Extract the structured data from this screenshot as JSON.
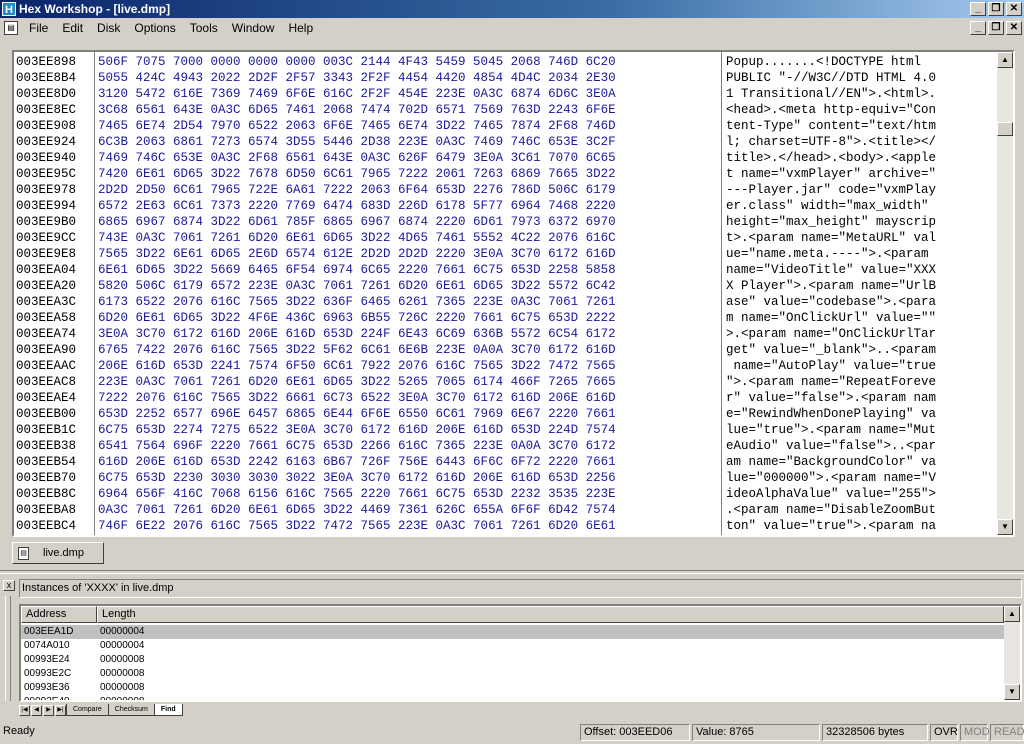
{
  "window": {
    "app_icon_glyph": "H",
    "title": "Hex Workshop - [live.dmp]",
    "min_glyph": "_",
    "max_glyph": "❐",
    "close_glyph": "✕"
  },
  "menu": {
    "doc_icon": "page-icon",
    "items": [
      "File",
      "Edit",
      "Disk",
      "Options",
      "Tools",
      "Window",
      "Help"
    ]
  },
  "hex_view": {
    "rows": [
      {
        "addr": "003EE898",
        "hex": "506F 7075 7000 0000 0000 0000 003C 2144 4F43 5459 5045 2068 746D 6C20",
        "ascii": "Popup.......<!DOCTYPE html "
      },
      {
        "addr": "003EE8B4",
        "hex": "5055 424C 4943 2022 2D2F 2F57 3343 2F2F 4454 4420 4854 4D4C 2034 2E30",
        "ascii": "PUBLIC \"-//W3C//DTD HTML 4.0"
      },
      {
        "addr": "003EE8D0",
        "hex": "3120 5472 616E 7369 7469 6F6E 616C 2F2F 454E 223E 0A3C 6874 6D6C 3E0A",
        "ascii": "1 Transitional//EN\">.<html>."
      },
      {
        "addr": "003EE8EC",
        "hex": "3C68 6561 643E 0A3C 6D65 7461 2068 7474 702D 6571 7569 763D 2243 6F6E",
        "ascii": "<head>.<meta http-equiv=\"Con"
      },
      {
        "addr": "003EE908",
        "hex": "7465 6E74 2D54 7970 6522 2063 6F6E 7465 6E74 3D22 7465 7874 2F68 746D",
        "ascii": "tent-Type\" content=\"text/htm"
      },
      {
        "addr": "003EE924",
        "hex": "6C3B 2063 6861 7273 6574 3D55 5446 2D38 223E 0A3C 7469 746C 653E 3C2F",
        "ascii": "l; charset=UTF-8\">.<title></"
      },
      {
        "addr": "003EE940",
        "hex": "7469 746C 653E 0A3C 2F68 6561 643E 0A3C 626F 6479 3E0A 3C61 7070 6C65",
        "ascii": "title>.</head>.<body>.<apple"
      },
      {
        "addr": "003EE95C",
        "hex": "7420 6E61 6D65 3D22 7678 6D50 6C61 7965 7222 2061 7263 6869 7665 3D22",
        "ascii": "t name=\"vxmPlayer\" archive=\""
      },
      {
        "addr": "003EE978",
        "hex": "2D2D 2D50 6C61 7965 722E 6A61 7222 2063 6F64 653D 2276 786D 506C 6179",
        "ascii": "---Player.jar\" code=\"vxmPlay"
      },
      {
        "addr": "003EE994",
        "hex": "6572 2E63 6C61 7373 2220 7769 6474 683D 226D 6178 5F77 6964 7468 2220",
        "ascii": "er.class\" width=\"max_width\" "
      },
      {
        "addr": "003EE9B0",
        "hex": "6865 6967 6874 3D22 6D61 785F 6865 6967 6874 2220 6D61 7973 6372 6970",
        "ascii": "height=\"max_height\" mayscrip"
      },
      {
        "addr": "003EE9CC",
        "hex": "743E 0A3C 7061 7261 6D20 6E61 6D65 3D22 4D65 7461 5552 4C22 2076 616C",
        "ascii": "t>.<param name=\"MetaURL\" val"
      },
      {
        "addr": "003EE9E8",
        "hex": "7565 3D22 6E61 6D65 2E6D 6574 612E 2D2D 2D2D 2220 3E0A 3C70 6172 616D",
        "ascii": "ue=\"name.meta.----\">.<param "
      },
      {
        "addr": "003EEA04",
        "hex": "6E61 6D65 3D22 5669 6465 6F54 6974 6C65 2220 7661 6C75 653D 2258 5858",
        "ascii": "name=\"VideoTitle\" value=\"XXX"
      },
      {
        "addr": "003EEA20",
        "hex": "5820 506C 6179 6572 223E 0A3C 7061 7261 6D20 6E61 6D65 3D22 5572 6C42",
        "ascii": "X Player\">.<param name=\"UrlB"
      },
      {
        "addr": "003EEA3C",
        "hex": "6173 6522 2076 616C 7565 3D22 636F 6465 6261 7365 223E 0A3C 7061 7261",
        "ascii": "ase\" value=\"codebase\">.<para"
      },
      {
        "addr": "003EEA58",
        "hex": "6D20 6E61 6D65 3D22 4F6E 436C 6963 6B55 726C 2220 7661 6C75 653D 2222",
        "ascii": "m name=\"OnClickUrl\" value=\"\""
      },
      {
        "addr": "003EEA74",
        "hex": "3E0A 3C70 6172 616D 206E 616D 653D 224F 6E43 6C69 636B 5572 6C54 6172",
        "ascii": ">.<param name=\"OnClickUrlTar"
      },
      {
        "addr": "003EEA90",
        "hex": "6765 7422 2076 616C 7565 3D22 5F62 6C61 6E6B 223E 0A0A 3C70 6172 616D",
        "ascii": "get\" value=\"_blank\">..<param"
      },
      {
        "addr": "003EEAAC",
        "hex": "206E 616D 653D 2241 7574 6F50 6C61 7922 2076 616C 7565 3D22 7472 7565",
        "ascii": " name=\"AutoPlay\" value=\"true"
      },
      {
        "addr": "003EEAC8",
        "hex": "223E 0A3C 7061 7261 6D20 6E61 6D65 3D22 5265 7065 6174 466F 7265 7665",
        "ascii": "\">.<param name=\"RepeatForeve"
      },
      {
        "addr": "003EEAE4",
        "hex": "7222 2076 616C 7565 3D22 6661 6C73 6522 3E0A 3C70 6172 616D 206E 616D",
        "ascii": "r\" value=\"false\">.<param nam"
      },
      {
        "addr": "003EEB00",
        "hex": "653D 2252 6577 696E 6457 6865 6E44 6F6E 6550 6C61 7969 6E67 2220 7661",
        "ascii": "e=\"RewindWhenDonePlaying\" va"
      },
      {
        "addr": "003EEB1C",
        "hex": "6C75 653D 2274 7275 6522 3E0A 3C70 6172 616D 206E 616D 653D 224D 7574",
        "ascii": "lue=\"true\">.<param name=\"Mut"
      },
      {
        "addr": "003EEB38",
        "hex": "6541 7564 696F 2220 7661 6C75 653D 2266 616C 7365 223E 0A0A 3C70 6172",
        "ascii": "eAudio\" value=\"false\">..<par"
      },
      {
        "addr": "003EEB54",
        "hex": "616D 206E 616D 653D 2242 6163 6B67 726F 756E 6443 6F6C 6F72 2220 7661",
        "ascii": "am name=\"BackgroundColor\" va"
      },
      {
        "addr": "003EEB70",
        "hex": "6C75 653D 2230 3030 3030 3022 3E0A 3C70 6172 616D 206E 616D 653D 2256",
        "ascii": "lue=\"000000\">.<param name=\"V"
      },
      {
        "addr": "003EEB8C",
        "hex": "6964 656F 416C 7068 6156 616C 7565 2220 7661 6C75 653D 2232 3535 223E",
        "ascii": "ideoAlphaValue\" value=\"255\">"
      },
      {
        "addr": "003EEBA8",
        "hex": "0A3C 7061 7261 6D20 6E61 6D65 3D22 4469 7361 626C 655A 6F6F 6D42 7574",
        "ascii": ".<param name=\"DisableZoomBut"
      },
      {
        "addr": "003EEBC4",
        "hex": "746F 6E22 2076 616C 7565 3D22 7472 7565 223E 0A3C 7061 7261 6D20 6E61",
        "ascii": "ton\" value=\"true\">.<param na"
      }
    ]
  },
  "doc_tab": {
    "icon": "page-icon",
    "label": "live.dmp"
  },
  "results": {
    "header": "Instances of 'XXXX' in live.dmp",
    "col_address": "Address",
    "col_length": "Length",
    "rows": [
      {
        "address": "003EEA1D",
        "length": "00000004"
      },
      {
        "address": "0074A010",
        "length": "00000004"
      },
      {
        "address": "00993E24",
        "length": "00000008"
      },
      {
        "address": "00993E2C",
        "length": "00000008"
      },
      {
        "address": "00993E36",
        "length": "00000008"
      },
      {
        "address": "00993E40",
        "length": "00000008"
      }
    ],
    "tabs": [
      "Compare",
      "Checksum",
      "Find"
    ],
    "active_tab": "Find"
  },
  "status": {
    "ready": "Ready",
    "offset": "Offset: 003EED06",
    "value": "Value: 8765",
    "size": "32328506 bytes",
    "ovr": "OVR",
    "mod": "MOD",
    "read": "READ"
  }
}
